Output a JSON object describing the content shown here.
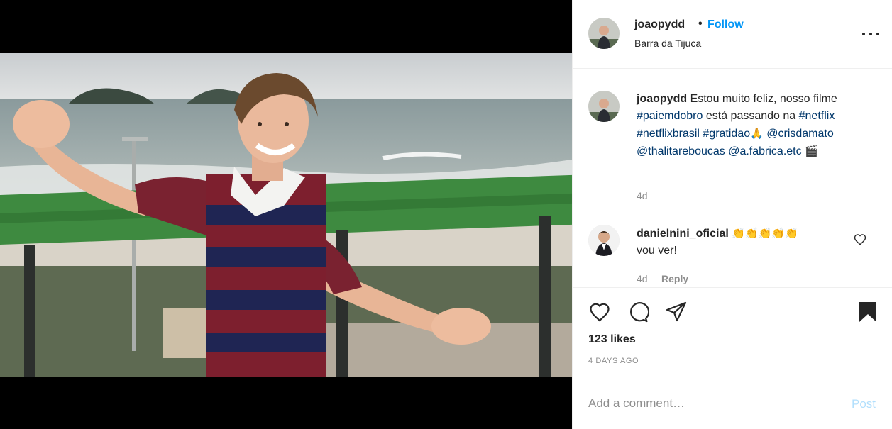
{
  "post": {
    "username": "joaopydd",
    "dot": "•",
    "follow_label": "Follow",
    "location": "Barra da Tijuca"
  },
  "caption": {
    "username": "joaopydd",
    "text_1": "Estou muito feliz, nosso filme ",
    "tag_1": "#paiemdobro",
    "text_2": " está passando na ",
    "tag_2": "#netflix",
    "tag_3": "#netflixbrasil",
    "tag_4": "#gratidao",
    "emoji_1": "🙏",
    "tag_5": "@crisdamato",
    "tag_6": "@thalitareboucas",
    "tag_7": "@a.fabrica.etc",
    "emoji_2": "🎬",
    "age": "4d"
  },
  "comment": {
    "username": "danielnini_oficial",
    "emoji": "👏👏👏👏👏",
    "text": "vou ver!",
    "age": "4d",
    "reply_label": "Reply"
  },
  "actions": {
    "icons": [
      "heart-icon",
      "comment-icon",
      "share-icon",
      "bookmark-icon"
    ],
    "likes": "123 likes",
    "date": "4 DAYS AGO"
  },
  "add_comment": {
    "placeholder": "Add a comment…",
    "post_label": "Post"
  },
  "colors": {
    "link": "#0095f6",
    "tag": "#00376b",
    "muted": "#8e8e8e"
  }
}
